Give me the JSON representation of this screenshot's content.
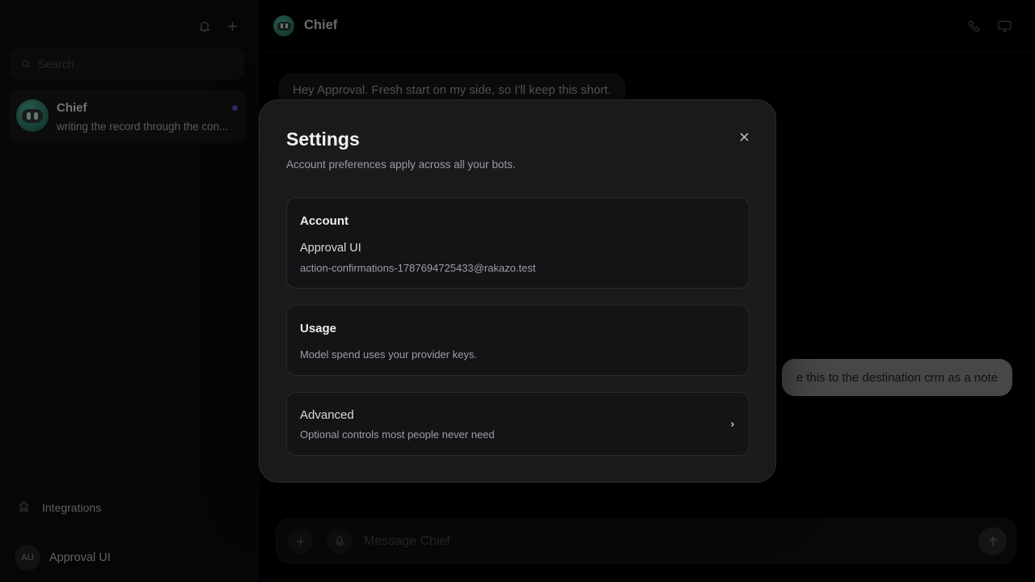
{
  "sidebar": {
    "search_placeholder": "Search",
    "chats": [
      {
        "name": "Chief",
        "preview": "writing the record through the con..."
      }
    ],
    "integrations_label": "Integrations",
    "user": {
      "initials": "AU",
      "name": "Approval UI"
    }
  },
  "main": {
    "header_title": "Chief",
    "messages": {
      "bot": "Hey Approval. Fresh start on my side, so I'll keep this short.",
      "user": "e this to the destination crm as a note"
    },
    "composer_placeholder": "Message Chief"
  },
  "modal": {
    "title": "Settings",
    "subtitle": "Account preferences apply across all your bots.",
    "account": {
      "title": "Account",
      "name": "Approval UI",
      "email": "action-confirmations-1787694725433@rakazo.test"
    },
    "usage": {
      "title": "Usage",
      "text": "Model spend uses your provider keys."
    },
    "advanced": {
      "title": "Advanced",
      "text": "Optional controls most people never need"
    }
  },
  "icons": {
    "bell": "bell-icon",
    "plus": "plus-icon",
    "search": "search-icon",
    "phone": "phone-icon",
    "monitor": "monitor-icon",
    "puzzle": "puzzle-icon",
    "mic": "mic-icon",
    "send": "arrow-up-icon",
    "close": "close-icon",
    "chevron": "chevron-right-icon"
  },
  "colors": {
    "unread_dot": "#6b4fd1",
    "bot_avatar": "#3a9a86"
  }
}
